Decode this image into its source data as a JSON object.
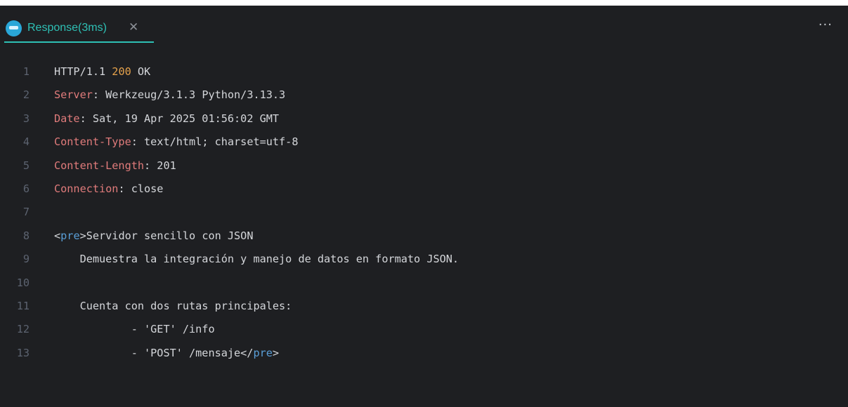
{
  "tab": {
    "icon": "rest-client-icon",
    "label": "Response(3ms)",
    "close_glyph": "✕"
  },
  "toolbar": {
    "more_glyph": "···"
  },
  "colors": {
    "background": "#1e1f22",
    "accent": "#2ec0b5",
    "header_key": "#e07b7b",
    "status_code": "#e5a24c",
    "html_tag": "#5a9fd8",
    "text": "#d4d6da",
    "line_number": "#5c6370"
  },
  "lines": [
    {
      "n": "1",
      "parts": [
        {
          "t": "HTTP/1.1 "
        },
        {
          "t": "200",
          "c": "num"
        },
        {
          "t": " OK"
        }
      ]
    },
    {
      "n": "2",
      "parts": [
        {
          "t": "Server",
          "c": "k"
        },
        {
          "t": ": Werkzeug/3.1.3 Python/3.13.3"
        }
      ]
    },
    {
      "n": "3",
      "parts": [
        {
          "t": "Date",
          "c": "k"
        },
        {
          "t": ": Sat, 19 Apr 2025 01:56:02 GMT"
        }
      ]
    },
    {
      "n": "4",
      "parts": [
        {
          "t": "Content-Type",
          "c": "k"
        },
        {
          "t": ": text/html; charset=utf-8"
        }
      ]
    },
    {
      "n": "5",
      "parts": [
        {
          "t": "Content-Length",
          "c": "k"
        },
        {
          "t": ": 201"
        }
      ]
    },
    {
      "n": "6",
      "parts": [
        {
          "t": "Connection",
          "c": "k"
        },
        {
          "t": ": close"
        }
      ]
    },
    {
      "n": "7",
      "parts": []
    },
    {
      "n": "8",
      "parts": [
        {
          "t": "<"
        },
        {
          "t": "pre",
          "c": "tag"
        },
        {
          "t": ">Servidor sencillo con JSON"
        }
      ]
    },
    {
      "n": "9",
      "parts": [
        {
          "t": "    Demuestra la integración y manejo de datos en formato JSON."
        }
      ]
    },
    {
      "n": "10",
      "parts": []
    },
    {
      "n": "11",
      "parts": [
        {
          "t": "    Cuenta con dos rutas principales:"
        }
      ]
    },
    {
      "n": "12",
      "parts": [
        {
          "t": "            - 'GET' /info"
        }
      ]
    },
    {
      "n": "13",
      "parts": [
        {
          "t": "            - 'POST' /mensaje</"
        },
        {
          "t": "pre",
          "c": "tag"
        },
        {
          "t": ">"
        }
      ]
    }
  ]
}
